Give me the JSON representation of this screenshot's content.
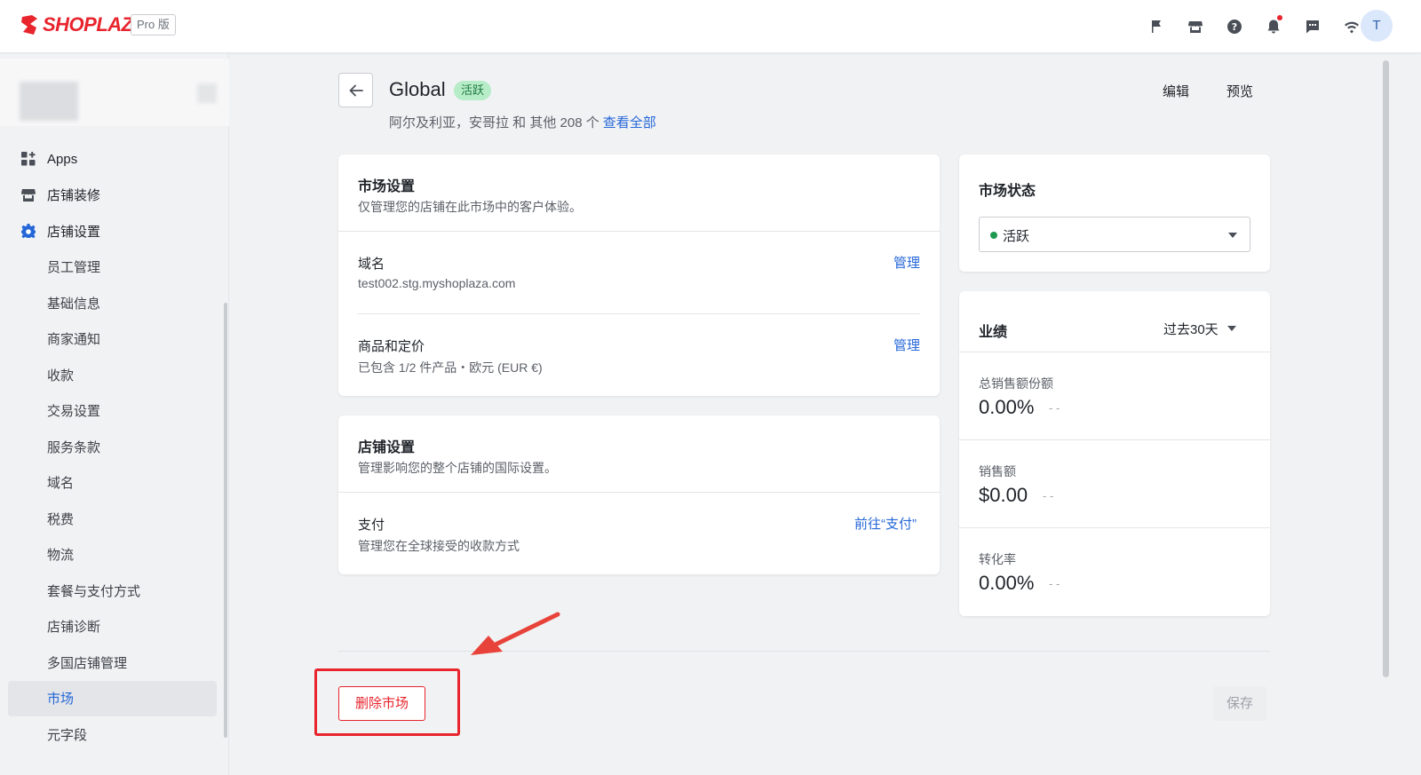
{
  "topbar": {
    "brand": "SHOPLAZZA",
    "plan_badge": "Pro 版",
    "icons": [
      "flag-icon",
      "store-icon",
      "help-icon",
      "bell-icon",
      "chat-icon",
      "wifi-icon"
    ],
    "avatar_initial": "T"
  },
  "sidebar": {
    "items": [
      {
        "label": "Apps",
        "icon": "apps-icon"
      },
      {
        "label": "店铺装修",
        "icon": "storefront-icon"
      },
      {
        "label": "店铺设置",
        "icon": "settings-icon"
      },
      {
        "label": "员工管理"
      },
      {
        "label": "基础信息"
      },
      {
        "label": "商家通知"
      },
      {
        "label": "收款"
      },
      {
        "label": "交易设置"
      },
      {
        "label": "服务条款"
      },
      {
        "label": "域名"
      },
      {
        "label": "税费"
      },
      {
        "label": "物流"
      },
      {
        "label": "套餐与支付方式"
      },
      {
        "label": "店铺诊断"
      },
      {
        "label": "多国店铺管理"
      },
      {
        "label": "市场"
      },
      {
        "label": "元字段"
      }
    ]
  },
  "header": {
    "title": "Global",
    "status": "活跃",
    "subtitle": "阿尔及利亚，安哥拉 和 其他 208 个",
    "view_all": "查看全部",
    "edit": "编辑",
    "preview": "预览"
  },
  "market_settings": {
    "title": "市场设置",
    "desc": "仅管理您的店铺在此市场中的客户体验。",
    "domain_title": "域名",
    "domain_value": "test002.stg.myshoplaza.com",
    "domain_action": "管理",
    "products_title": "商品和定价",
    "products_value": "已包含 1/2 件产品・欧元 (EUR €)",
    "products_action": "管理"
  },
  "store_settings": {
    "title": "店铺设置",
    "desc": "管理影响您的整个店铺的国际设置。",
    "payment_title": "支付",
    "payment_value": "管理您在全球接受的收款方式",
    "payment_action": "前往“支付”"
  },
  "market_status": {
    "title": "市场状态",
    "selected": "活跃",
    "status_color": "#1d9a4f"
  },
  "performance": {
    "title": "业绩",
    "range": "过去30天",
    "metrics": [
      {
        "label": "总销售额份额",
        "value": "0.00%",
        "trend": "- -"
      },
      {
        "label": "销售额",
        "value": "$0.00",
        "trend": "- -"
      },
      {
        "label": "转化率",
        "value": "0.00%",
        "trend": "- -"
      }
    ]
  },
  "footer": {
    "delete": "删除市场",
    "save": "保存"
  },
  "colors": {
    "brand": "#e8242d",
    "link": "#2567d8",
    "active_tag_bg": "#b6ecc8"
  }
}
